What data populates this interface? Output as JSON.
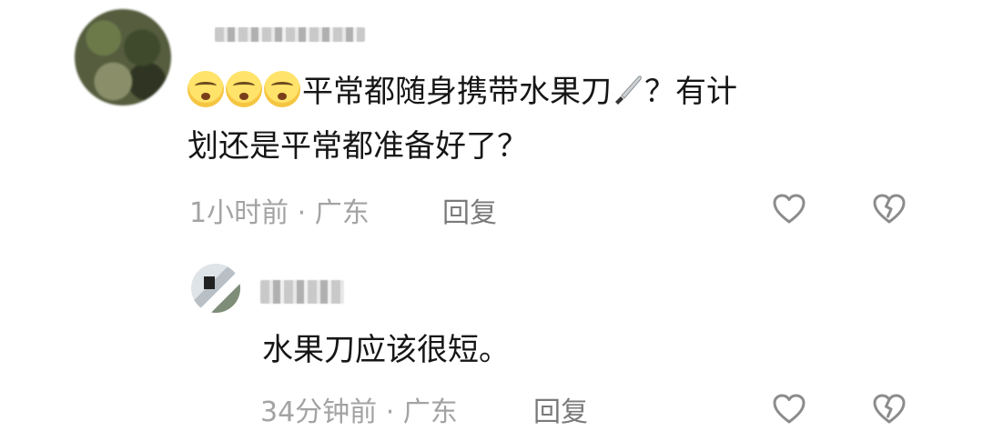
{
  "comment": {
    "text_line1": "平常都随身携带水果刀",
    "text_line1b": "？有计",
    "text_line2": "划还是平常都准备好了？",
    "emojis": [
      "sleepy-face-emoji",
      "sleepy-face-emoji",
      "sleepy-face-emoji"
    ],
    "inline_icon": "kitchen-knife-emoji",
    "time": "1小时前",
    "location": "广东",
    "separator": " · ",
    "reply_label": "回复"
  },
  "reply": {
    "text": "水果刀应该很短。",
    "time": "34分钟前",
    "location": "广东",
    "separator": " · ",
    "reply_label": "回复"
  },
  "icons": {
    "like": "heart-outline-icon",
    "dislike": "broken-heart-icon"
  },
  "colors": {
    "text": "#161616",
    "meta": "#a3a3a3",
    "reply_link": "#7a7a7a",
    "icon": "#8c8c8c"
  }
}
